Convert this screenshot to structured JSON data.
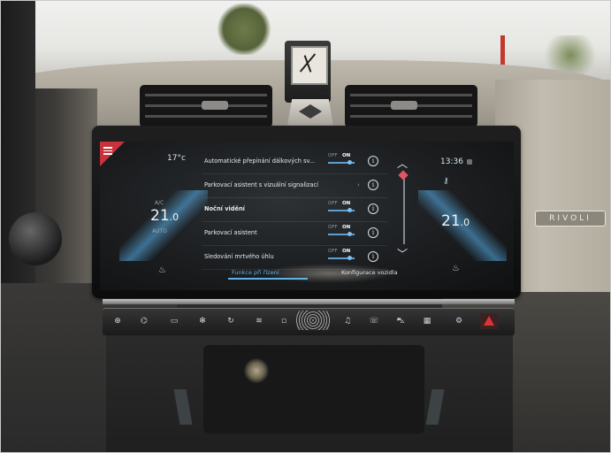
{
  "climate": {
    "outside_temp": "17°c",
    "left_ac_label": "A/C",
    "left_temp_int": "21",
    "left_temp_dec": ".0",
    "left_mode": "AUTO",
    "right_temp_int": "21",
    "right_temp_dec": ".0"
  },
  "status": {
    "time": "13:36"
  },
  "menu": {
    "rows": [
      {
        "label": "Automatické přepínání dálkových sv...",
        "has_toggle": true,
        "off": "OFF",
        "on": "ON",
        "state": "on"
      },
      {
        "label": "Parkovací asistent s vizuální signalizací",
        "has_toggle": false
      },
      {
        "label": "Noční vidění",
        "has_toggle": true,
        "off": "OFF",
        "on": "ON",
        "state": "on"
      },
      {
        "label": "Parkovací asistent",
        "has_toggle": true,
        "off": "OFF",
        "on": "ON",
        "state": "on"
      },
      {
        "label": "Sledování mrtvého úhlu",
        "has_toggle": true,
        "off": "OFF",
        "on": "ON",
        "state": "on"
      }
    ],
    "info_glyph": "i"
  },
  "tabs": {
    "active": "Funkce při řízení",
    "inactive": "Konfigurace vozidla"
  },
  "dash": {
    "badge_text": "RIVOLI"
  },
  "icons": {
    "menu": "hamburger-icon",
    "scroll_up": "chevron-up-icon",
    "scroll_down": "chevron-down-icon",
    "key": "key-icon",
    "seat": "seat-heat-icon"
  },
  "colors": {
    "accent_red": "#c8323a",
    "accent_blue": "#5fb3e6",
    "screen_bg": "#1a1c1e"
  }
}
